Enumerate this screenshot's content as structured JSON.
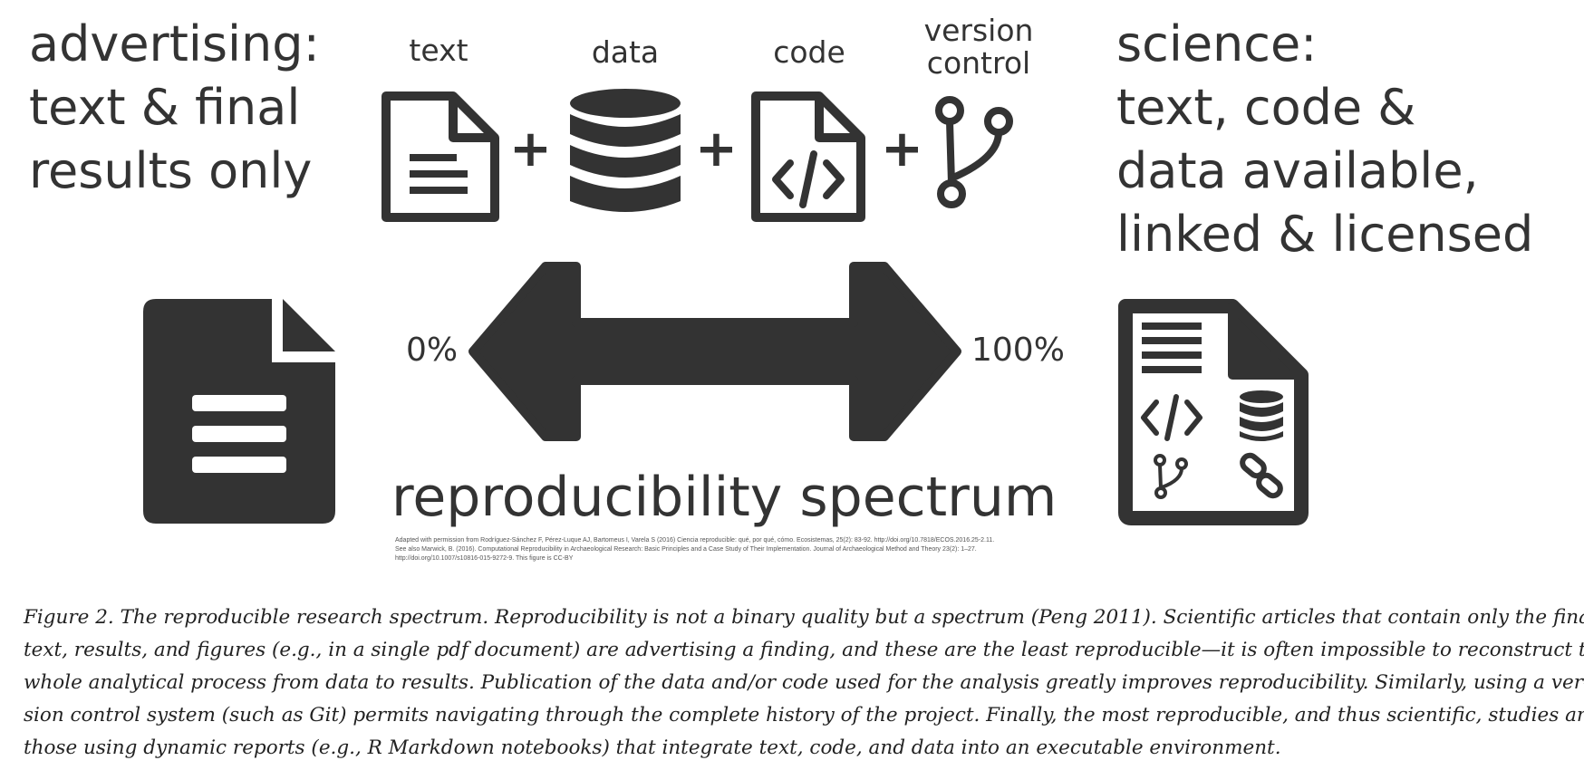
{
  "left_heading": [
    "advertising:",
    "text & final",
    "results only"
  ],
  "right_heading": [
    "science:",
    "text, code &",
    "data available,",
    "linked & licensed"
  ],
  "components": {
    "text": "text",
    "data": "data",
    "code": "code",
    "version_control": [
      "version",
      "control"
    ],
    "plus_sign": "+"
  },
  "spectrum": {
    "left_percent": "0%",
    "right_percent": "100%",
    "label": "reproducibility spectrum"
  },
  "attribution": [
    "Adapted with permission from Rodríguez-Sánchez F, Pérez-Luque AJ, Bartomeus I, Varela S (2016) Ciencia reproducible: qué, por qué, cómo. Ecosistemas, 25(2): 83-92. http://doi.org/10.7818/ECOS.2016.25-2.11.",
    "See also Marwick, B. (2016). Computational Reproducibility in Archaeological Research: Basic Principles and a Case Study of Their Implementation. Journal of Archaeological Method and Theory 23(2): 1–27.",
    "http://doi.org/10.1007/s10816-015-9272-9. This figure is CC-BY"
  ],
  "caption_lines": [
    "Figure 2. The reproducible research spectrum. Reproducibility is not a binary quality but a spectrum (Peng 2011). Scientific articles that contain only the final",
    "text, results, and figures (e.g., in a single pdf document) are advertising a finding, and these are the least reproducible—it is often impossible to reconstruct the",
    "whole analytical process from data to results. Publication of the data and/or code used for the analysis greatly improves reproducibility. Similarly, using a ver-",
    "sion control system (such as Git) permits navigating through the complete history of the project. Finally, the most reproducible, and thus scientific, studies are",
    "those using dynamic reports (e.g., R Markdown notebooks) that integrate text, code, and data into an executable environment."
  ],
  "icons": [
    "text-document-icon",
    "database-icon",
    "code-document-icon",
    "version-control-icon",
    "document-filled-icon",
    "double-arrow-icon",
    "full-document-icon",
    "code-tag-icon",
    "small-database-icon",
    "small-branch-icon",
    "link-icon"
  ],
  "colors": {
    "ink": "#333333"
  }
}
